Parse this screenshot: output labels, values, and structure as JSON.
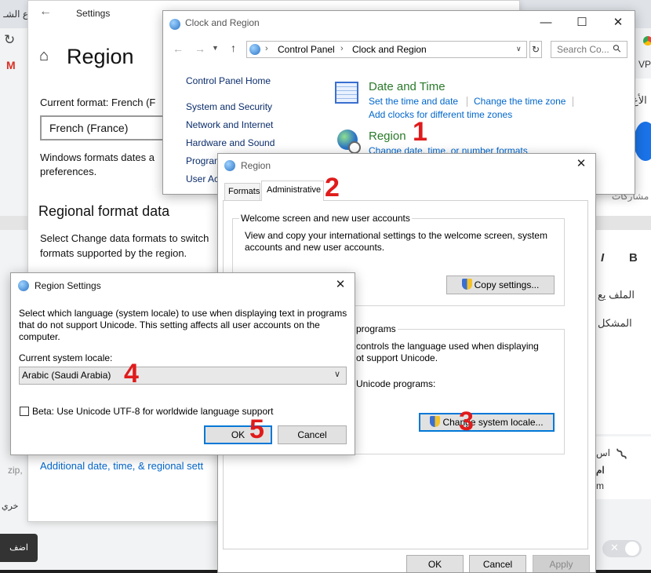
{
  "background": {
    "browser": {
      "rtl_top": "ع الشـ",
      "rtl_top_right": "VP",
      "rtl_right_1": "الأع",
      "rtl_right_2": "مشاركات",
      "rtl_right_3": "الملف يع",
      "rtl_right_4": "المشكل",
      "rtl_bottom_left": "خري",
      "rtl_bottom_right_1": "اس",
      "rtl_bottom_right_2": "ام",
      "rtl_bottom_right_3": "m",
      "add_button": "اضف",
      "zip_text": "zip,",
      "italic": "I",
      "bold": "B",
      "gmail_letter": "M"
    }
  },
  "settings": {
    "title": "Settings",
    "heading": "Region",
    "current_format_label": "Current format: French (F",
    "format_value": "French (France)",
    "desc": "Windows formats dates a",
    "desc2": "preferences.",
    "regional_heading": "Regional format data",
    "select_text": "Select Change data formats to switch",
    "select_text2": "formats supported by the region.",
    "additional_link": "Additional date, time, & regional sett"
  },
  "clock_region": {
    "title": "Clock and Region",
    "breadcrumb": [
      "Control Panel",
      "Clock and Region"
    ],
    "search_placeholder": "Search Co...",
    "sidebar": [
      "Control Panel Home",
      "System and Security",
      "Network and Internet",
      "Hardware and Sound",
      "Program",
      "User Ac"
    ],
    "date_time": {
      "title": "Date and Time",
      "links": [
        "Set the time and date",
        "Change the time zone",
        "Add clocks for different time zones"
      ]
    },
    "region": {
      "title": "Region",
      "link": "Change date, time, or number formats"
    }
  },
  "region_dialog": {
    "title": "Region",
    "tabs": [
      "Formats",
      "Administrative"
    ],
    "welcome_legend": "Welcome screen and new user accounts",
    "welcome_text": "View and copy your international settings to the welcome screen, system accounts and new user accounts.",
    "copy_button": "Copy settings...",
    "nonunicode_legend": "programs",
    "nonunicode_text1": "controls the language used when displaying",
    "nonunicode_text2": "ot support Unicode.",
    "nonunicode_text3": "Unicode programs:",
    "change_locale_button": "Change system locale...",
    "ok": "OK",
    "cancel": "Cancel",
    "apply": "Apply"
  },
  "region_settings": {
    "title": "Region Settings",
    "description": "Select which language (system locale) to use when displaying text in programs that do not support Unicode. This setting affects all user accounts on the computer.",
    "locale_label": "Current system locale:",
    "locale_value": "Arabic (Saudi Arabia)",
    "beta_label": "Beta: Use Unicode UTF-8 for worldwide language support",
    "ok": "OK",
    "cancel": "Cancel"
  },
  "annotations": [
    "1",
    "2",
    "3",
    "4",
    "5"
  ],
  "colors": {
    "link": "#0066cc",
    "green": "#2a7a2a",
    "accent": "#0078d7",
    "annotation": "#e01b1b"
  }
}
